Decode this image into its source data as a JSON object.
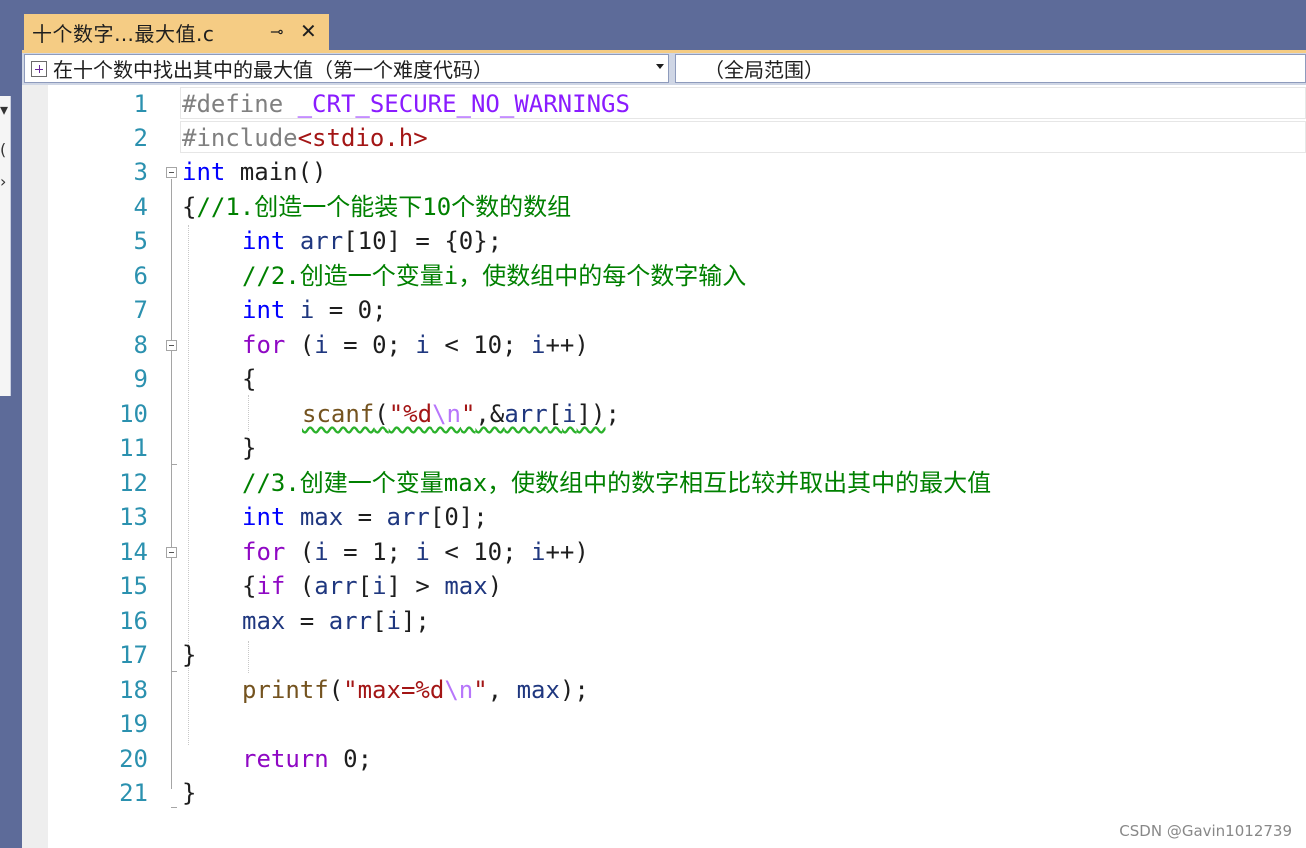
{
  "tab": {
    "title": "十个数字…最大值.c",
    "pin_glyph": "⊣",
    "close_glyph": "✕"
  },
  "navbar": {
    "scope_label": "在十个数中找出其中的最大值（第一个难度代码）",
    "member_label": "（全局范围）"
  },
  "line_numbers": [
    "1",
    "2",
    "3",
    "4",
    "5",
    "6",
    "7",
    "8",
    "9",
    "10",
    "11",
    "12",
    "13",
    "14",
    "15",
    "16",
    "17",
    "18",
    "19",
    "20",
    "21"
  ],
  "code": {
    "l1": {
      "a": "#define ",
      "b": "_CRT_SECURE_NO_WARNINGS"
    },
    "l2": {
      "a": "#include",
      "b": "<stdio.h>"
    },
    "l3": {
      "a": "int",
      "b": " main()"
    },
    "l4": {
      "a": "{",
      "b": "//1.创造一个能装下10个数的数组"
    },
    "l5": {
      "a": "int",
      "b": " ",
      "c": "arr",
      "d": "[10] = {0};"
    },
    "l6": {
      "a": "//2.创造一个变量i，使数组中的每个数字输入"
    },
    "l7": {
      "a": "int",
      "b": " ",
      "c": "i",
      "d": " = 0;"
    },
    "l8": {
      "a": "for",
      "b": " (",
      "c": "i",
      "d": " = 0; ",
      "e": "i",
      "f": " < 10; ",
      "g": "i",
      "h": "++)"
    },
    "l9": {
      "a": "{"
    },
    "l10": {
      "a": "scanf",
      "b": "(",
      "c": "\"%d",
      "d": "\\n",
      "e": "\"",
      "f": ",&",
      "g": "arr",
      "h": "[",
      "i": "i",
      "j": "])",
      ";": ";"
    },
    "l11": {
      "a": "}"
    },
    "l12": {
      "a": "//3.创建一个变量max，使数组中的数字相互比较并取出其中的最大值"
    },
    "l13": {
      "a": "int",
      "b": " ",
      "c": "max",
      "d": " = ",
      "e": "arr",
      "f": "[0];"
    },
    "l14": {
      "a": "for",
      "b": " (",
      "c": "i",
      "d": " = 1; ",
      "e": "i",
      "f": " < 10; ",
      "g": "i",
      "h": "++)"
    },
    "l15": {
      "a": "{",
      "b": "if",
      "c": " (",
      "d": "arr",
      "e": "[",
      "f": "i",
      "g": "] > ",
      "h": "max",
      "i": ")"
    },
    "l16": {
      "a": "max",
      "b": " = ",
      "c": "arr",
      "d": "[",
      "e": "i",
      "f": "];"
    },
    "l17": {
      "a": "}"
    },
    "l18": {
      "a": "printf",
      "b": "(",
      "c": "\"max=%d",
      "d": "\\n",
      "e": "\"",
      "f": ", ",
      "g": "max",
      "h": ");"
    },
    "l19": {},
    "l20": {
      "a": "return",
      "b": " 0;"
    },
    "l21": {
      "a": "}"
    }
  },
  "watermark": "CSDN @Gavin1012739",
  "colors": {
    "keyword": "#0000ff",
    "control": "#8f08c4",
    "comment": "#008000",
    "string": "#a31515",
    "line_number": "#2b91af",
    "tab_active": "#f5cc84"
  }
}
